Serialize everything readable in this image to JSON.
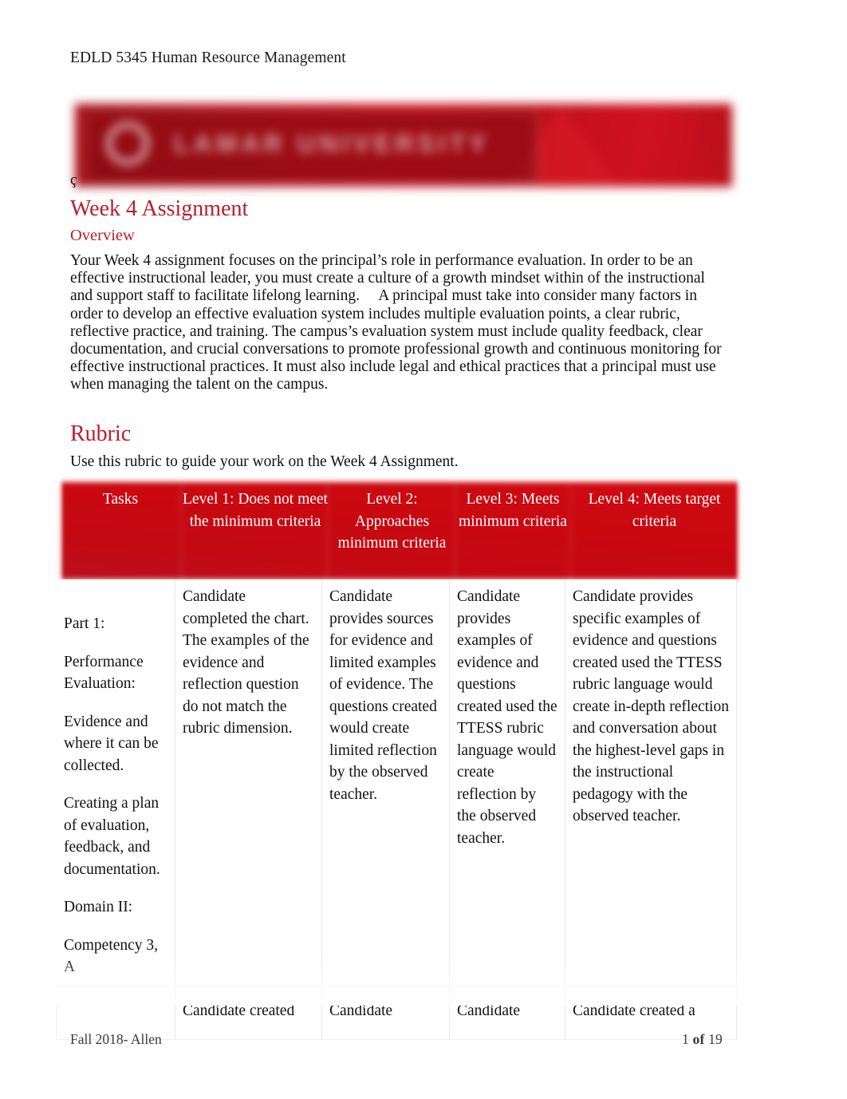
{
  "document": {
    "header_title": "EDLD 5345 Human Resource Management",
    "stray_char": "ç"
  },
  "banner": {
    "wordmark": "LAMAR UNIVERSITY",
    "accent_color": "#c4121d"
  },
  "sections": {
    "assignment_heading": "Week 4 Assignment",
    "overview_heading": "Overview",
    "overview_body": "Your Week 4 assignment focuses on the principal’s role in performance evaluation. In order to be an effective instructional leader, you must create a culture of a growth mindset within of the instructional and support staff to facilitate lifelong learning.     A principal must take into consider many factors in order to develop an effective evaluation system includes multiple evaluation points, a clear rubric, reflective practice, and training. The campus’s evaluation system must include quality feedback, clear documentation, and crucial conversations to promote professional growth and continuous monitoring for effective instructional practices. It must also include legal and ethical practices that a principal must use when managing the talent on the campus.",
    "rubric_heading": "Rubric",
    "rubric_intro": "Use this rubric to guide your work on the Week 4 Assignment."
  },
  "rubric_table": {
    "accent_color": "#c90810",
    "header_text_color": "#ffffff",
    "columns": [
      "Tasks",
      "Level 1: Does not meet the minimum criteria",
      "Level 2: Approaches minimum criteria",
      "Level 3: Meets minimum criteria",
      "Level 4: Meets target criteria"
    ],
    "rows": [
      {
        "task_lines": [
          "Part 1:",
          "Performance Evaluation:",
          "Evidence and where it can be collected.",
          "Creating a plan of evaluation, feedback, and documentation.",
          "Domain II:",
          "Competency 3, A"
        ],
        "level1": "Candidate completed the chart. The examples of the evidence and reflection question do not match the rubric dimension.",
        "level2": "Candidate provides sources for evidence and limited examples of evidence. The questions created would create limited reflection by the observed teacher.",
        "level3": "Candidate provides examples of evidence and questions created used the TTESS rubric language would create reflection by the observed teacher.",
        "level4": "Candidate provides specific examples of evidence and questions created used the TTESS rubric language would create in-depth reflection and conversation about the highest-level gaps in the instructional pedagogy with the observed teacher."
      },
      {
        "task_lines": [],
        "level1": "Candidate created",
        "level2": "Candidate",
        "level3": "Candidate",
        "level4": "Candidate created a"
      }
    ]
  },
  "footer": {
    "left": "Fall 2018- Allen",
    "page_number": "1",
    "of_label": "of",
    "page_total": "19"
  }
}
